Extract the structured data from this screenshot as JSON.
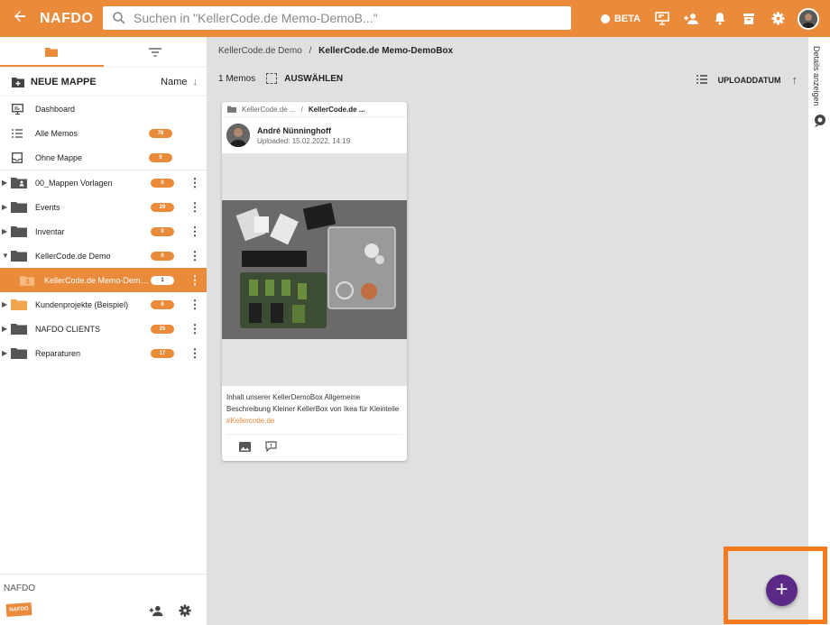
{
  "header": {
    "brand": "NAFDO",
    "search_placeholder": "Suchen in \"KellerCode.de Memo-DemoB...\"",
    "beta_label": "BETA",
    "color": "#ea8a3b"
  },
  "sidebar": {
    "new_folder_label": "NEUE MAPPE",
    "sort_label": "Name",
    "simple_items": [
      {
        "label": "Dashboard",
        "icon": "monitor-icon"
      },
      {
        "label": "Alle Memos",
        "icon": "list-icon",
        "badge": "78"
      },
      {
        "label": "Ohne Mappe",
        "icon": "inbox-icon",
        "badge": "0"
      }
    ],
    "folders": [
      {
        "label": "00_Mappen Vorlagen",
        "badge": "0",
        "expanded": false
      },
      {
        "label": "Events",
        "badge": "29",
        "expanded": false
      },
      {
        "label": "Inventar",
        "badge": "0",
        "expanded": false
      },
      {
        "label": "KellerCode.de Demo",
        "badge": "0",
        "expanded": true
      },
      {
        "label": "KellerCode.de Memo-DemoBox",
        "badge": "1",
        "selected": true
      },
      {
        "label": "Kundenprojekte (Beispiel)",
        "badge": "6",
        "expanded": false
      },
      {
        "label": "NAFDO CLIENTS",
        "badge": "25",
        "expanded": false
      },
      {
        "label": "Reparaturen",
        "badge": "17",
        "expanded": false
      }
    ],
    "footer_org": "NAFDO",
    "footer_logo": "NAFDO"
  },
  "main": {
    "breadcrumb_parent": "KellerCode.de Demo",
    "breadcrumb_sep": "/",
    "breadcrumb_current": "KellerCode.de Memo-DemoBox",
    "memo_count": "1 Memos",
    "select_label": "AUSWÄHLEN",
    "sort_label": "UPLOADDATUM"
  },
  "card": {
    "crumb_parent": "KellerCode.de ...",
    "crumb_sep": "/",
    "crumb_current": "KellerCode.de ...",
    "author": "André Nünninghoff",
    "uploaded": "Uploaded: 15.02.2022, 14:19",
    "desc_line1": "Inhalt unserer KellerDemoBox Allgemeine",
    "desc_line2": "Beschreibung Kleiner KellerBox von Ikea für Kleinteile",
    "tag": "#Kellercode.de"
  },
  "details_label": "Details anzeigen",
  "fab_label": "+"
}
